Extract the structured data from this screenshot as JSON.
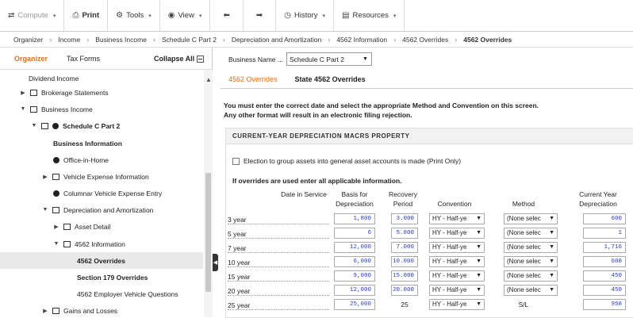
{
  "toolbar": {
    "compute": "Compute",
    "print": "Print",
    "tools": "Tools",
    "view": "View",
    "history": "History",
    "resources": "Resources"
  },
  "breadcrumb": [
    "Organizer",
    "Income",
    "Business Income",
    "Schedule C Part 2",
    "Depreciation and Amortization",
    "4562 Information",
    "4562 Overrides",
    "4562 Overrides"
  ],
  "sidebar": {
    "tab_organizer": "Organizer",
    "tab_forms": "Tax Forms",
    "collapse": "Collapse All",
    "items": [
      {
        "label": "Dividend Income"
      },
      {
        "label": "Brokerage Statements"
      },
      {
        "label": "Business Income"
      },
      {
        "label": "Schedule C Part 2"
      },
      {
        "label": "Business Information"
      },
      {
        "label": "Office-in-Home"
      },
      {
        "label": "Vehicle Expense Information"
      },
      {
        "label": "Columnar Vehicle Expense Entry"
      },
      {
        "label": "Depreciation and Amortization"
      },
      {
        "label": "Asset Detail"
      },
      {
        "label": "4562 Information"
      },
      {
        "label": "4562 Overrides"
      },
      {
        "label": "Section 179 Overrides"
      },
      {
        "label": "4562 Employer Vehicle Questions"
      },
      {
        "label": "Gains and Losses"
      }
    ]
  },
  "main": {
    "business_name_label": "Business Name ...",
    "business_name_value": "Schedule C Part 2",
    "tab1": "4562 Overrides",
    "tab2": "State 4562 Overrides",
    "message_line1": "You must enter the correct date and select the appropriate Method and Convention on this screen.",
    "message_line2": "Any other format will result in an electronic filing rejection.",
    "section_title": "CURRENT-YEAR DEPRECIATION MACRS PROPERTY",
    "checkbox_label": "Election to group assets into general asset accounts is made (Print Only)",
    "note": "If overrides are used enter all applicable information.",
    "col_date": "Date in Service",
    "col_basis": "Basis for Depreciation",
    "col_recovery": "Recovery Period",
    "col_convention": "Convention",
    "col_method": "Method",
    "col_current": "Current Year Depreciation",
    "rows": [
      {
        "label": "3 year",
        "basis": "1,800",
        "recovery": "3.000",
        "convention": "HY - Half-ye",
        "method": "(None selec",
        "current": "600"
      },
      {
        "label": "5 year",
        "basis": "6",
        "recovery": "5.000",
        "convention": "HY - Half-ye",
        "method": "(None selec",
        "current": "1"
      },
      {
        "label": "7 year",
        "basis": "12,000",
        "recovery": "7.000",
        "convention": "HY - Half-ye",
        "method": "(None selec",
        "current": "1,716"
      },
      {
        "label": "10 year",
        "basis": "6,000",
        "recovery": "10.000",
        "convention": "HY - Half-ye",
        "method": "(None selec",
        "current": "600"
      },
      {
        "label": "15 year",
        "basis": "9,000",
        "recovery": "15.000",
        "convention": "HY - Half-ye",
        "method": "(None selec",
        "current": "450"
      },
      {
        "label": "20 year",
        "basis": "12,000",
        "recovery": "20.000",
        "convention": "HY - Half-ye",
        "method": "(None selec",
        "current": "450"
      },
      {
        "label": "25 year",
        "basis": "25,000",
        "recovery": "25",
        "convention": "HY - Half-ye",
        "method": "S/L",
        "current": "958"
      }
    ]
  }
}
